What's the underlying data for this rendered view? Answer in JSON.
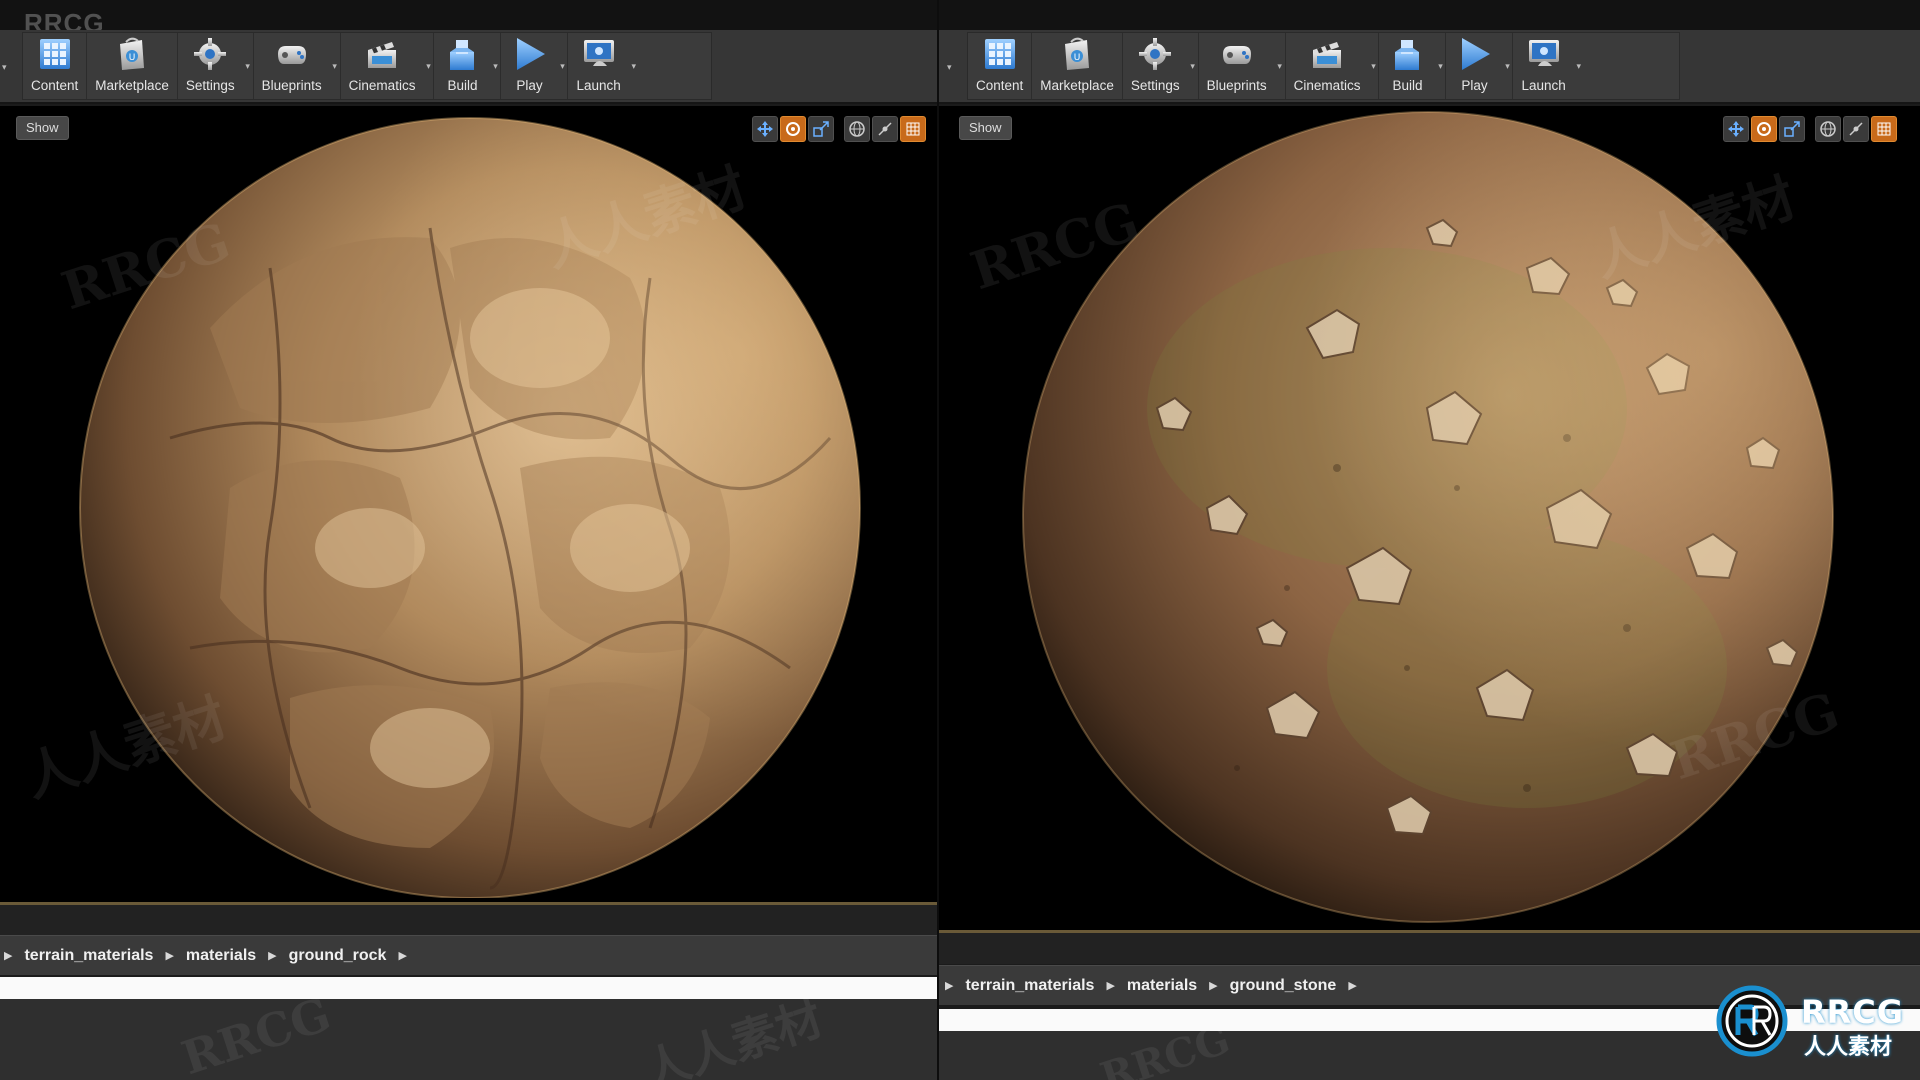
{
  "watermark_top": "RRCG",
  "watermark_text": "RRCG",
  "watermark_cn": "人人素材",
  "logo": {
    "brand": "RRCG",
    "sub": "人人素材"
  },
  "toolbar": {
    "content": "Content",
    "marketplace": "Marketplace",
    "settings": "Settings",
    "blueprints": "Blueprints",
    "cinematics": "Cinematics",
    "build": "Build",
    "play": "Play",
    "launch": "Launch"
  },
  "viewport": {
    "show": "Show"
  },
  "left_panel": {
    "breadcrumbs": [
      "terrain_materials",
      "materials",
      "ground_rock"
    ],
    "material": "rocky dirt sphere"
  },
  "right_panel": {
    "breadcrumbs": [
      "terrain_materials",
      "materials",
      "ground_stone"
    ],
    "material": "dirt with stones sphere"
  },
  "colors": {
    "toolbar_bg": "#363636",
    "viewport_bg": "#000000",
    "breadcrumb_bg": "#3a3a3a",
    "accent_orange": "#c86a1a",
    "dirt_light": "#c9a47a",
    "dirt_dark": "#4a3020",
    "logo_blue": "#1a8fcf"
  },
  "icons": [
    "content-icon",
    "marketplace-icon",
    "settings-icon",
    "blueprints-icon",
    "cinematics-icon",
    "build-icon",
    "play-icon",
    "launch-icon"
  ]
}
